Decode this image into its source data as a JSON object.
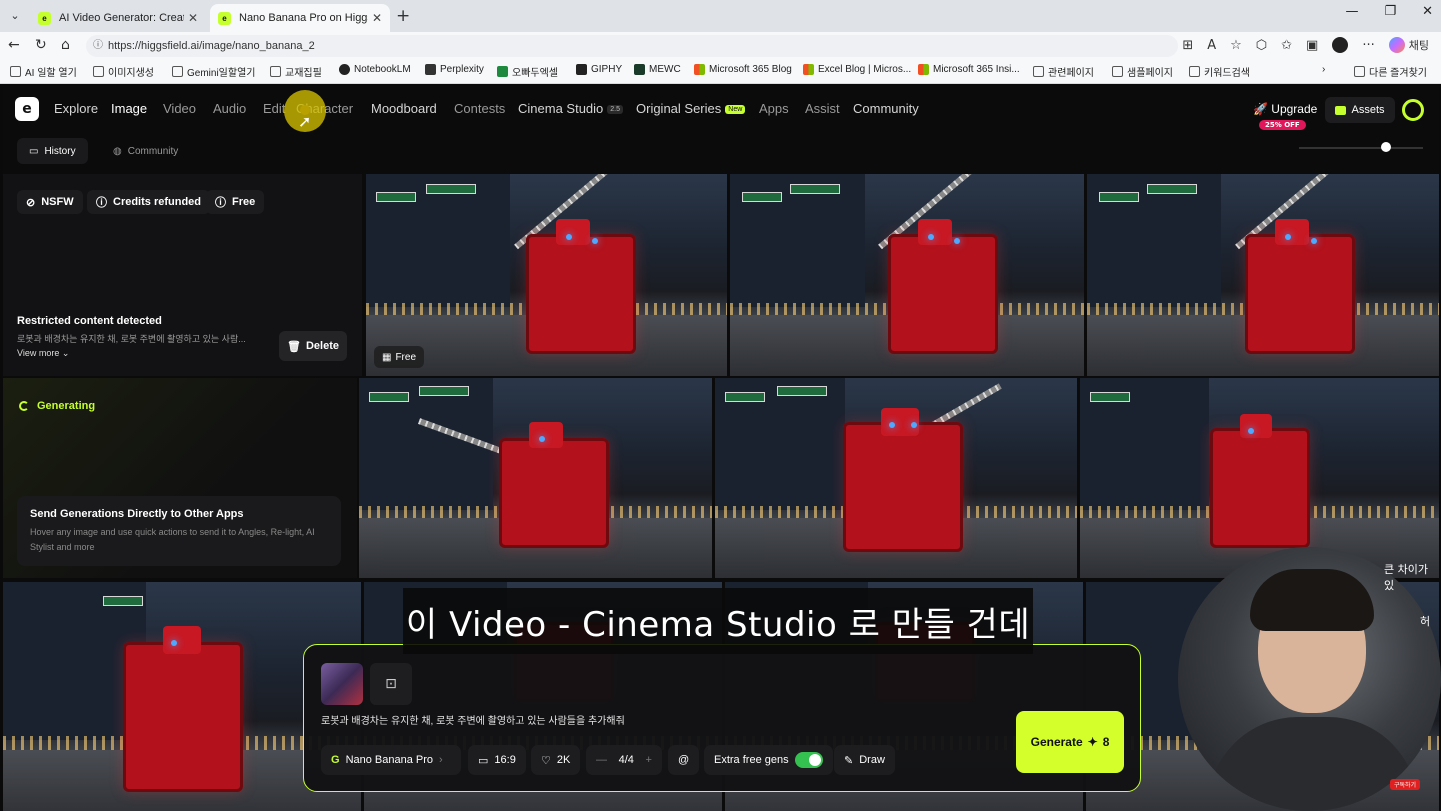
{
  "browser": {
    "tabs": [
      {
        "title": "AI Video Generator: Create stunnin",
        "active": false
      },
      {
        "title": "Nano Banana Pro on Higgsfield: N",
        "active": true
      }
    ],
    "url": "https://higgsfield.ai/image/nano_banana_2",
    "copilot_label": "채팅",
    "bookmarks": [
      "AI 일할 열기",
      "이미지생성",
      "Gemini일할열기",
      "교재집필",
      "NotebookLM",
      "Perplexity",
      "오빠두엑셀",
      "GIPHY",
      "MEWC",
      "Microsoft 365 Blog",
      "Excel Blog | Micros...",
      "Microsoft 365 Insi...",
      "관련페이지",
      "샘플페이지",
      "키워드검색"
    ],
    "other_bookmarks": "다른 즐겨찾기"
  },
  "nav": {
    "items": [
      "Explore",
      "Image",
      "Video",
      "Audio",
      "Edit",
      "Character",
      "Moodboard",
      "Contests",
      "Cinema Studio",
      "Original Series",
      "Apps",
      "Assist",
      "Community"
    ],
    "active": "Image",
    "cinema_badge": "2.5",
    "new_badge": "New",
    "upgrade": "Upgrade",
    "upgrade_badge": "25% OFF",
    "assets": "Assets",
    "accent": "#c5ff2e"
  },
  "subnav": {
    "history": "History",
    "community": "Community"
  },
  "restricted": {
    "chips": [
      "NSFW",
      "Credits refunded",
      "Free"
    ],
    "title": "Restricted content detected",
    "desc": "로봇과 배경차는 유지한 채, 로봇 주변에 촬영하고 있는 사람...",
    "view_more": "View more",
    "delete": "Delete"
  },
  "free_chip": "Free",
  "generating": {
    "label": "Generating",
    "send_title": "Send Generations Directly to Other Apps",
    "send_desc": "Hover any image and use quick actions to send it to Angles, Re-light, AI Stylist and more"
  },
  "prompt_panel": {
    "prompt": "로봇과 배경차는 유지한 채, 로봇 주변에 촬영하고 있는 사람들을 추가해줘",
    "model": "Nano Banana Pro",
    "aspect": "16:9",
    "quality": "2K",
    "count": "4/4",
    "mention": "@",
    "extra_free_gens": "Extra free gens",
    "extra_free_on": true,
    "draw": "Draw",
    "generate": "Generate",
    "generate_cost": "8"
  },
  "caption": "이 Video - Cinema Studio 로 만들 건데",
  "webcam": {
    "side_text_1": "큰 차이가 있",
    "side_text_2": "허",
    "subscribe": "구독하기"
  }
}
